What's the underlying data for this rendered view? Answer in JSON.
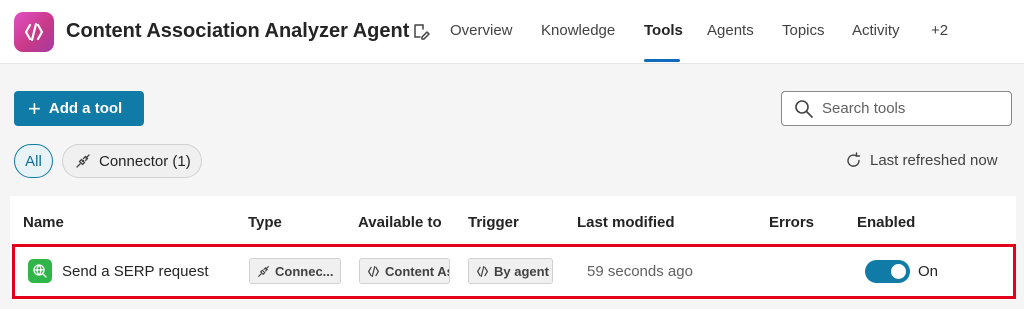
{
  "header": {
    "agent_title": "Content Association Analyzer Agent",
    "logo_icon": "code-brackets-icon",
    "tabs": [
      {
        "label": "Overview"
      },
      {
        "label": "Knowledge"
      },
      {
        "label": "Tools",
        "active": true
      },
      {
        "label": "Agents"
      },
      {
        "label": "Topics"
      },
      {
        "label": "Activity"
      },
      {
        "label": "+2"
      }
    ]
  },
  "toolbar": {
    "add_label": "Add a tool",
    "search_placeholder": "Search tools"
  },
  "filters": {
    "all_label": "All",
    "connector_label": "Connector (1)",
    "refresh_label": "Last refreshed now"
  },
  "table": {
    "columns": [
      "Name",
      "Type",
      "Available to",
      "Trigger",
      "Last modified",
      "Errors",
      "Enabled"
    ],
    "rows": [
      {
        "name": "Send a SERP request",
        "type": "Connec...",
        "available_to": "Content As",
        "trigger": "By agent",
        "last_modified": "59 seconds ago",
        "errors": "",
        "enabled_label": "On",
        "enabled": true
      }
    ]
  },
  "colors": {
    "accent": "#0f7ba6",
    "highlight": "#e3001b",
    "row_icon": "#2fb54a"
  }
}
